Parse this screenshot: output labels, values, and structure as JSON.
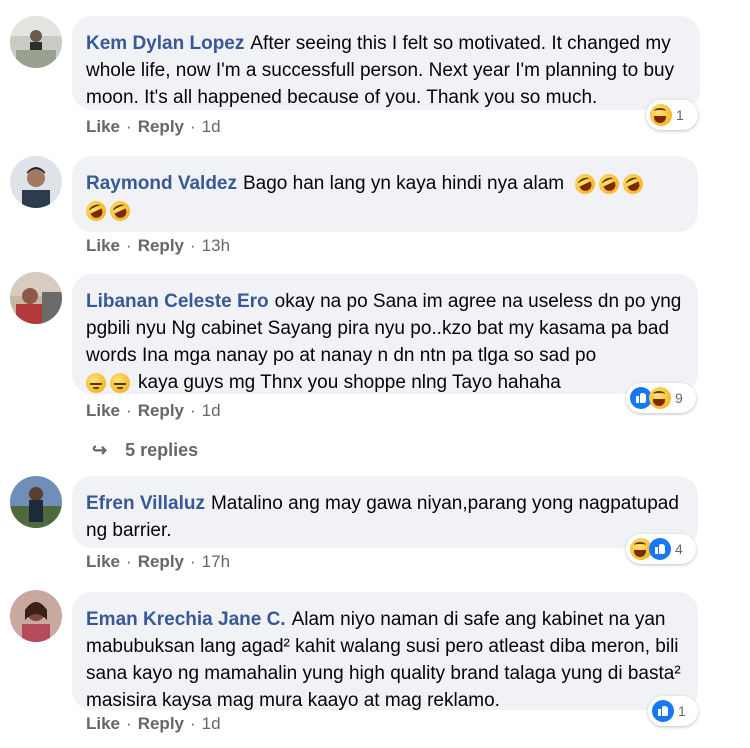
{
  "comments": [
    {
      "author": "Kem Dylan Lopez",
      "text": "After seeing this I felt so motivated. It changed my whole life, now I'm a successfull person. Next year I'm planning to buy moon. It's all happened because of you. Thank you so much.",
      "like": "Like",
      "reply": "Reply",
      "time": "1d",
      "reaction_count": "1",
      "reactions": [
        "laugh-emoji"
      ]
    },
    {
      "author": "Raymond Valdez",
      "text": "Bago han lang yn kaya hindi nya alam",
      "emojis_inline": [
        "rofl-emoji",
        "rofl-emoji",
        "rofl-emoji",
        "rofl-emoji",
        "rofl-emoji"
      ],
      "like": "Like",
      "reply": "Reply",
      "time": "13h"
    },
    {
      "author": "Libanan Celeste Ero",
      "text": "okay na po Sana im agree na useless dn po yng pgbili nyu Ng cabinet Sayang pira nyu po..kzo bat my kasama pa bad words Ina mga nanay po at nanay n dn ntn pa tlga so sad po",
      "text_after_emojis": "kaya guys mg Thnx you shoppe nlng Tayo hahaha",
      "emojis_inline": [
        "sad-emoji",
        "sad-emoji"
      ],
      "like": "Like",
      "reply": "Reply",
      "time": "1d",
      "reaction_count": "9",
      "reactions": [
        "like-reaction",
        "laugh-emoji"
      ],
      "replies_label": "5 replies"
    },
    {
      "author": "Efren Villaluz",
      "text": "Matalino ang may gawa niyan,parang yong nagpatupad ng barrier.",
      "like": "Like",
      "reply": "Reply",
      "time": "17h",
      "reaction_count": "4",
      "reactions": [
        "laugh-emoji",
        "like-reaction"
      ]
    },
    {
      "author": "Eman Krechia Jane C.",
      "text": "Alam niyo naman di safe ang kabinet na yan mabubuksan lang agad² kahit walang susi pero atleast diba meron, bili sana kayo ng mamahalin yung high quality brand talaga yung di basta² masisira kaysa mag mura kaayo at mag reklamo.",
      "like": "Like",
      "reply": "Reply",
      "time": "1d",
      "reaction_count": "1",
      "reactions": [
        "like-reaction"
      ]
    }
  ],
  "colors": {
    "author": "#385898",
    "bubble": "#f0f2f5",
    "muted": "#65676b",
    "like_blue": "#1877f2"
  }
}
